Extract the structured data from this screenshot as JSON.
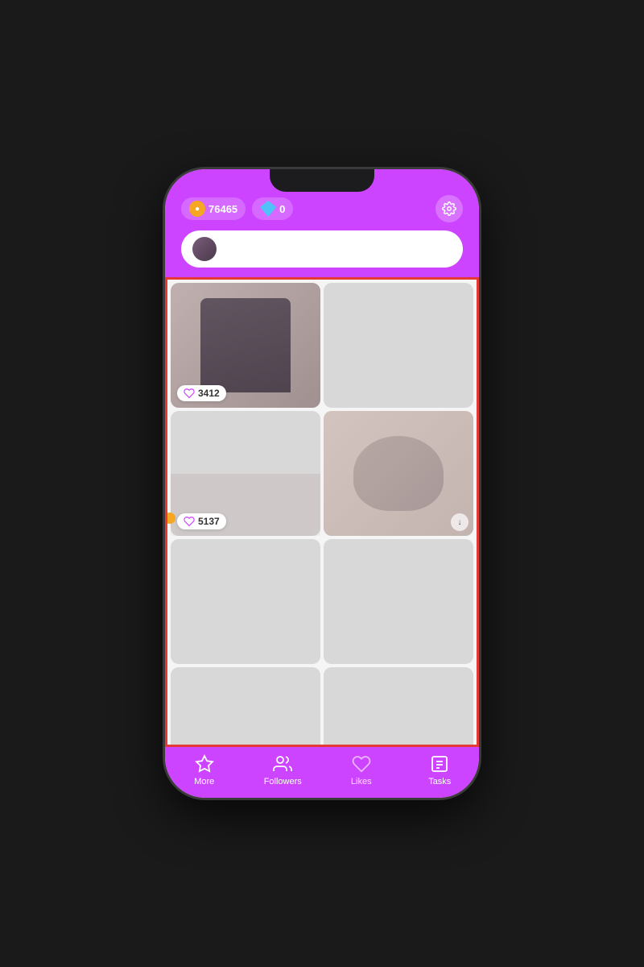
{
  "header": {
    "coins_value": "76465",
    "diamonds_value": "0",
    "settings_label": "⚙"
  },
  "grid": {
    "items": [
      {
        "id": 1,
        "has_image": true,
        "image_type": "figure",
        "like_count": "3412"
      },
      {
        "id": 2,
        "has_image": false,
        "like_count": null
      },
      {
        "id": 3,
        "has_image": false,
        "like_count": "5137"
      },
      {
        "id": 4,
        "has_image": true,
        "image_type": "face",
        "like_count": null
      },
      {
        "id": 5,
        "has_image": false,
        "like_count": null
      },
      {
        "id": 6,
        "has_image": false,
        "like_count": null
      },
      {
        "id": 7,
        "has_image": false,
        "like_count": null
      },
      {
        "id": 8,
        "has_image": false,
        "like_count": null
      },
      {
        "id": 9,
        "has_image": false,
        "like_count": null
      },
      {
        "id": 10,
        "has_image": false,
        "like_count": null
      }
    ]
  },
  "bottom_nav": {
    "items": [
      {
        "id": "more",
        "label": "More",
        "active": false
      },
      {
        "id": "followers",
        "label": "Followers",
        "active": false
      },
      {
        "id": "likes",
        "label": "Likes",
        "active": true
      },
      {
        "id": "tasks",
        "label": "Tasks",
        "active": false
      }
    ]
  }
}
